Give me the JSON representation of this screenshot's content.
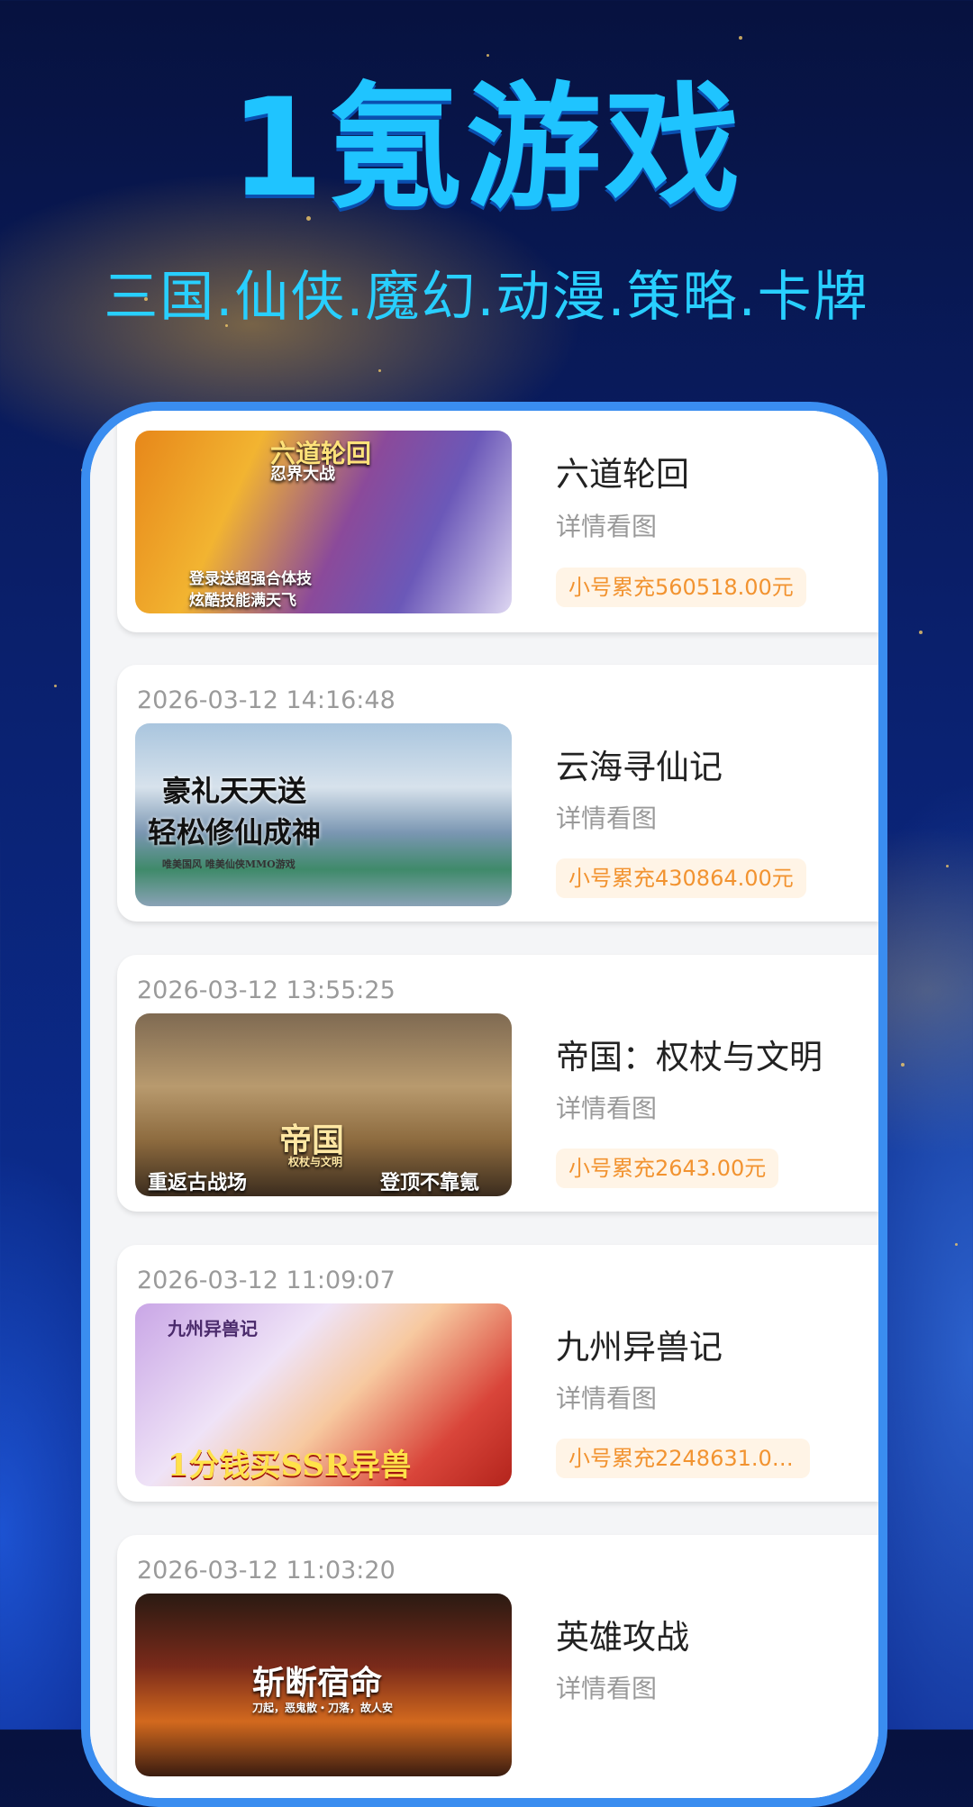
{
  "hero": {
    "title": "1氪游戏",
    "subtitle": "三国.仙侠.魔幻.动漫.策略.卡牌"
  },
  "games": [
    {
      "name": "六道轮回",
      "desc": "详情看图",
      "recharge": "小号累充560518.00元",
      "timestamp": "",
      "banner_text": [
        "六道轮回",
        "忍界大战",
        "登录送超强合体技",
        "炫酷技能满天飞"
      ]
    },
    {
      "name": "云海寻仙记",
      "desc": "详情看图",
      "recharge": "小号累充430864.00元",
      "timestamp": "2026-03-12 14:16:48",
      "banner_text": [
        "豪礼天天送",
        "轻松修仙成神",
        "唯美国风 唯美仙侠MMO游戏"
      ]
    },
    {
      "name": "帝国：权杖与文明",
      "desc": "详情看图",
      "recharge": "小号累充2643.00元",
      "timestamp": "2026-03-12 13:55:25",
      "banner_text": [
        "帝国",
        "权杖与文明",
        "重返古战场",
        "登顶不靠氪"
      ]
    },
    {
      "name": "九州异兽记",
      "desc": "详情看图",
      "recharge": "小号累充2248631.00...",
      "timestamp": "2026-03-12 11:09:07",
      "banner_text": [
        "九州异兽记",
        "1分钱买SSR异兽"
      ]
    },
    {
      "name": "英雄攻战",
      "desc": "详情看图",
      "recharge": "",
      "timestamp": "2026-03-12 11:03:20",
      "banner_text": [
        "斩断宿命",
        "刀起，恶鬼散・刀落，故人安"
      ]
    }
  ],
  "colors": {
    "title": "#1fc4ff",
    "phone_frame": "#3a8df0",
    "badge_bg": "#fff4e6",
    "badge_text": "#f29330"
  }
}
